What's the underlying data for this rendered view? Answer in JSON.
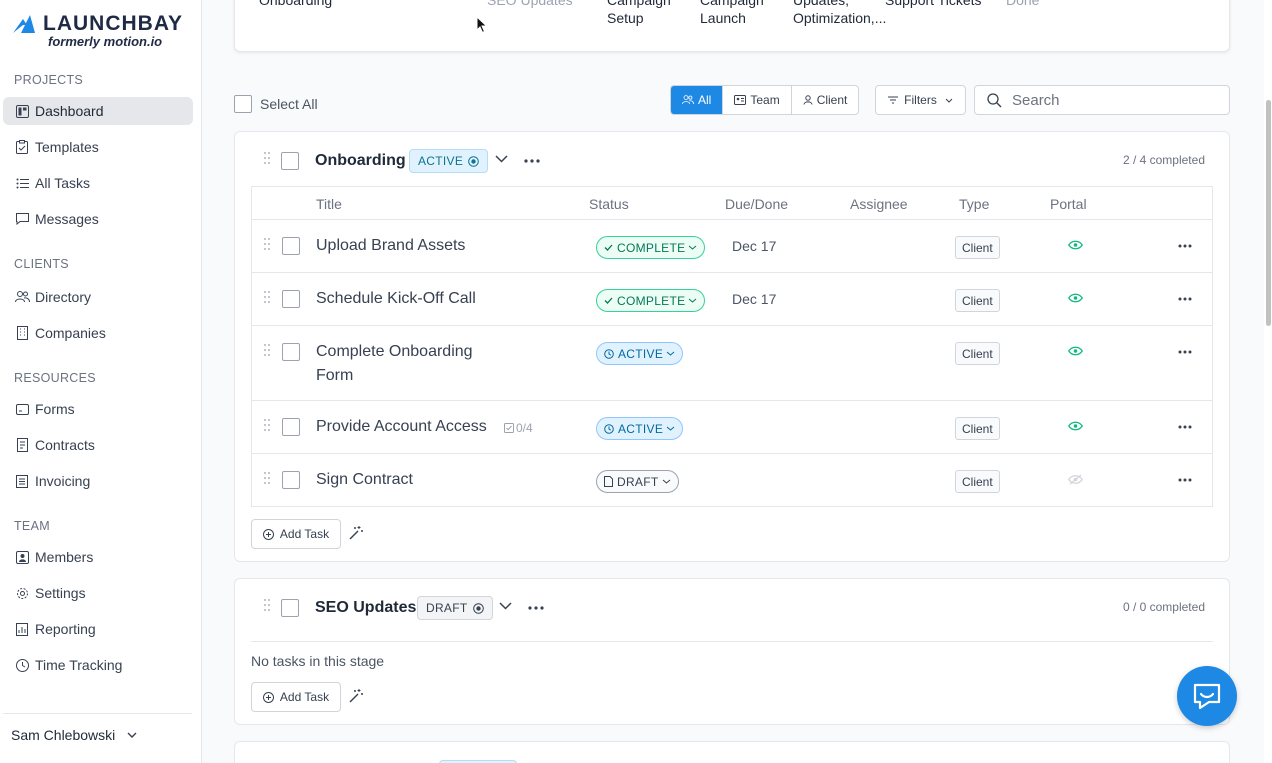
{
  "brand": {
    "name": "LAUNCHBAY",
    "subtitle": "formerly motion.io"
  },
  "sidebar": {
    "projects_title": "PROJECTS",
    "projects": [
      {
        "label": "Dashboard",
        "icon": "dashboard-icon"
      },
      {
        "label": "Templates",
        "icon": "clipboard-icon"
      },
      {
        "label": "All Tasks",
        "icon": "list-icon"
      },
      {
        "label": "Messages",
        "icon": "message-icon"
      }
    ],
    "clients_title": "CLIENTS",
    "clients": [
      {
        "label": "Directory",
        "icon": "people-icon"
      },
      {
        "label": "Companies",
        "icon": "building-icon"
      }
    ],
    "resources_title": "RESOURCES",
    "resources": [
      {
        "label": "Forms",
        "icon": "form-icon"
      },
      {
        "label": "Contracts",
        "icon": "document-icon"
      },
      {
        "label": "Invoicing",
        "icon": "invoice-icon"
      }
    ],
    "team_title": "TEAM",
    "team": [
      {
        "label": "Members",
        "icon": "member-icon"
      },
      {
        "label": "Settings",
        "icon": "gear-icon"
      },
      {
        "label": "Reporting",
        "icon": "report-icon"
      },
      {
        "label": "Time Tracking",
        "icon": "clock-icon"
      }
    ],
    "user": "Sam Chlebowski"
  },
  "stages_strip": [
    {
      "line1": "Onboarding",
      "line2": ""
    },
    {
      "line1": "SEO Updates",
      "line2": ""
    },
    {
      "line1": "Campaign",
      "line2": "Setup"
    },
    {
      "line1": "Campaign",
      "line2": "Launch"
    },
    {
      "line1": "Updates,",
      "line2": "Optimization,..."
    },
    {
      "line1": "Support Tickets",
      "line2": ""
    },
    {
      "line1": "Done",
      "line2": ""
    }
  ],
  "toolbar": {
    "select_all": "Select All",
    "segments": [
      "All",
      "Team",
      "Client"
    ],
    "filters": "Filters",
    "search_placeholder": "Search"
  },
  "table_headers": [
    "Title",
    "Status",
    "Due/Done",
    "Assignee",
    "Type",
    "Portal"
  ],
  "stages": [
    {
      "title": "Onboarding",
      "status": "ACTIVE",
      "completed": "2 / 4 completed",
      "tasks": [
        {
          "title": "Upload Brand Assets",
          "status": "COMPLETE",
          "due": "Dec 17",
          "type": "Client",
          "portal": "visible"
        },
        {
          "title": "Schedule Kick-Off Call",
          "status": "COMPLETE",
          "due": "Dec 17",
          "type": "Client",
          "portal": "visible"
        },
        {
          "title_line1": "Complete Onboarding",
          "title_line2": "Form",
          "status": "ACTIVE",
          "due": "",
          "type": "Client",
          "portal": "visible"
        },
        {
          "title": "Provide Account Access",
          "subtasks": "0/4",
          "status": "ACTIVE",
          "due": "",
          "type": "Client",
          "portal": "visible"
        },
        {
          "title": "Sign Contract",
          "status": "DRAFT",
          "due": "",
          "type": "Client",
          "portal": "hidden"
        }
      ],
      "add_task": "Add Task"
    },
    {
      "title": "SEO Updates",
      "status": "DRAFT",
      "completed": "0 / 0 completed",
      "empty": "No tasks in this stage",
      "add_task": "Add Task"
    }
  ],
  "colors": {
    "accent": "#1e88e5",
    "complete": "#047857",
    "active": "#0369a1",
    "eye": "#10b981"
  }
}
